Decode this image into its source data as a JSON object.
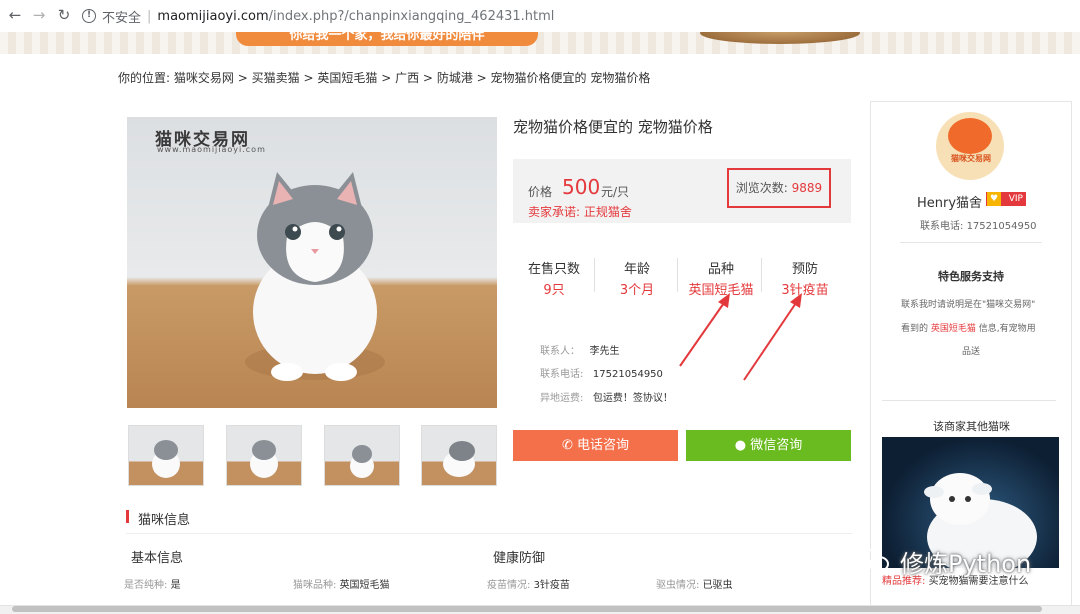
{
  "browser": {
    "insecure_label": "不安全",
    "url_host": "maomijiaoyi.com",
    "url_path": "/index.php?/chanpinxiangqing_462431.html"
  },
  "banner": {
    "slogan": "你给我一个家，我给你最好的陪伴"
  },
  "breadcrumb": {
    "prefix": "你的位置:",
    "items": [
      "猫咪交易网",
      "买猫卖猫",
      "英国短毛猫",
      "广西",
      "防城港",
      "宠物猫价格便宜的 宠物猫价格"
    ],
    "separator": ">"
  },
  "photo": {
    "watermark_title": "猫咪交易网",
    "watermark_url": "www.maomijiaoyi.com"
  },
  "product": {
    "title": "宠物猫价格便宜的 宠物猫价格",
    "price_label": "价格",
    "price": "500",
    "price_unit": "元/只",
    "promise": "卖家承诺: 正规猫舍",
    "views_label": "浏览次数:",
    "views": "9889"
  },
  "stats": [
    {
      "label": "在售只数",
      "value": "9只"
    },
    {
      "label": "年龄",
      "value": "3个月"
    },
    {
      "label": "品种",
      "value": "英国短毛猫"
    },
    {
      "label": "预防",
      "value": "3针疫苗"
    }
  ],
  "contact": {
    "person_label": "联系人：",
    "person": "李先生",
    "phone_label": "联系电话:",
    "phone": "17521054950",
    "shipping_label": "异地运费:",
    "shipping": "包运费！签协议！"
  },
  "buttons": {
    "phone": "电话咨询",
    "wechat": "微信咨询"
  },
  "info": {
    "section_title": "猫咪信息",
    "basic_title": "基本信息",
    "health_title": "健康防御",
    "items": [
      {
        "label": "是否纯种:",
        "value": "是"
      },
      {
        "label": "猫咪品种:",
        "value": "英国短毛猫"
      },
      {
        "label": "疫苗情况:",
        "value": "3针疫苗"
      },
      {
        "label": "驱虫情况:",
        "value": "已驱虫"
      }
    ]
  },
  "sidebar": {
    "logo_text": "猫咪交易网",
    "shop_name": "Henry猫舍",
    "vip": "VIP",
    "phone_label": "联系电话:",
    "phone": "17521054950",
    "service_title": "特色服务支持",
    "service_line1": "联系我时请说明是在\"猫咪交易网\"",
    "service_line2_prefix": "看到的",
    "service_line2_link": "英国短毛猫",
    "service_line2_suffix": "信息,有宠物用",
    "service_line3": "品送",
    "other_title": "该商家其他猫咪",
    "rec_label": "精品推荐:",
    "rec_text": "买宠物猫需要注意什么"
  },
  "overlay": {
    "watermark": "修炼Python"
  },
  "colors": {
    "accent_red": "#e4393c",
    "phone_btn": "#f4704b",
    "wechat_btn": "#6abb1f"
  }
}
